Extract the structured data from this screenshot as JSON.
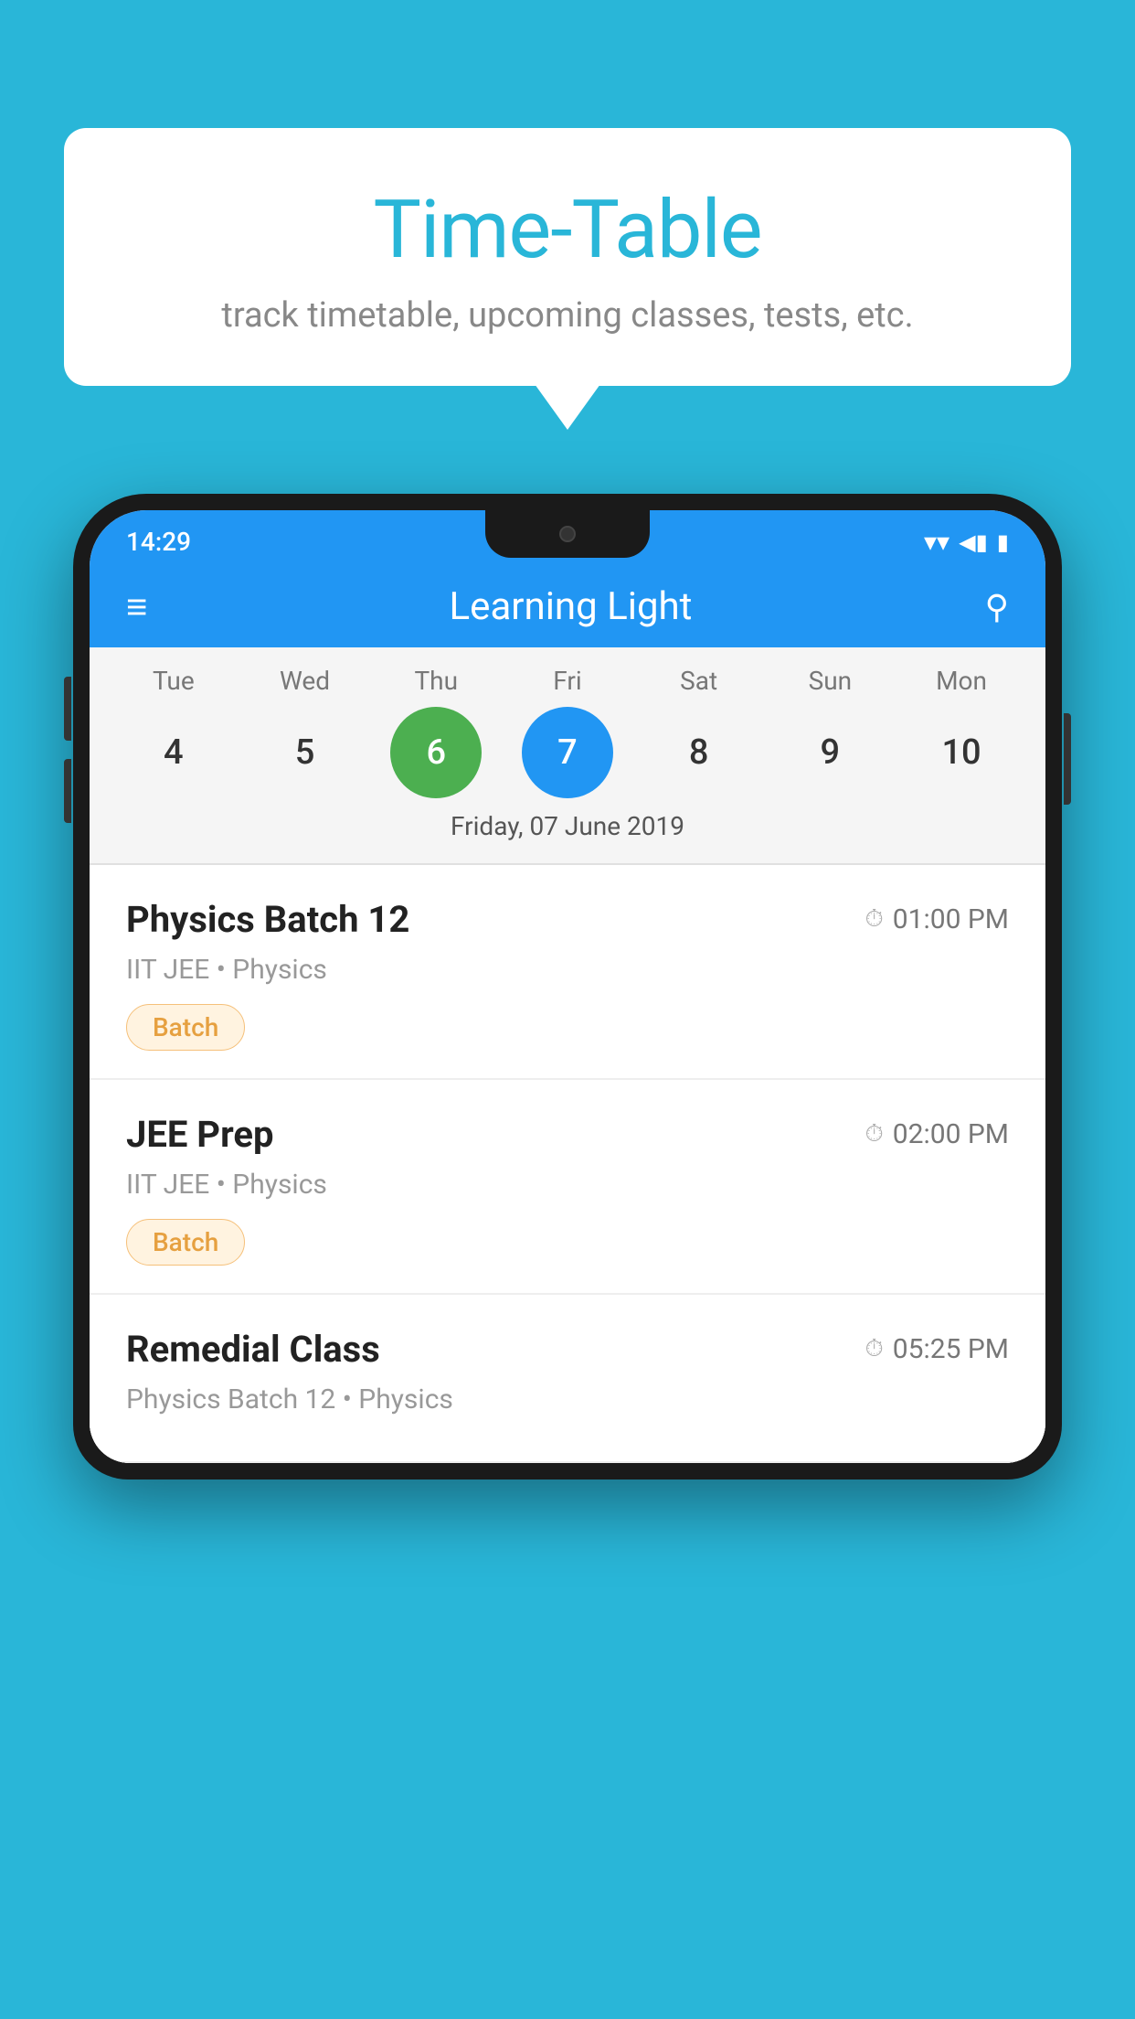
{
  "background_color": "#29b6d8",
  "bubble": {
    "title": "Time-Table",
    "subtitle": "track timetable, upcoming classes, tests, etc."
  },
  "status_bar": {
    "time": "14:29"
  },
  "app_bar": {
    "title": "Learning Light"
  },
  "calendar": {
    "days": [
      {
        "label": "Tue",
        "number": "4",
        "state": "normal"
      },
      {
        "label": "Wed",
        "number": "5",
        "state": "normal"
      },
      {
        "label": "Thu",
        "number": "6",
        "state": "today"
      },
      {
        "label": "Fri",
        "number": "7",
        "state": "selected"
      },
      {
        "label": "Sat",
        "number": "8",
        "state": "normal"
      },
      {
        "label": "Sun",
        "number": "9",
        "state": "normal"
      },
      {
        "label": "Mon",
        "number": "10",
        "state": "normal"
      }
    ],
    "selected_date_label": "Friday, 07 June 2019"
  },
  "classes": [
    {
      "name": "Physics Batch 12",
      "time": "01:00 PM",
      "meta": "IIT JEE • Physics",
      "badge": "Batch"
    },
    {
      "name": "JEE Prep",
      "time": "02:00 PM",
      "meta": "IIT JEE • Physics",
      "badge": "Batch"
    },
    {
      "name": "Remedial Class",
      "time": "05:25 PM",
      "meta": "Physics Batch 12 • Physics",
      "badge": ""
    }
  ],
  "icons": {
    "hamburger": "≡",
    "search": "🔍",
    "clock": "🕐",
    "wifi": "▾",
    "signal": "◀",
    "battery": "▮"
  }
}
